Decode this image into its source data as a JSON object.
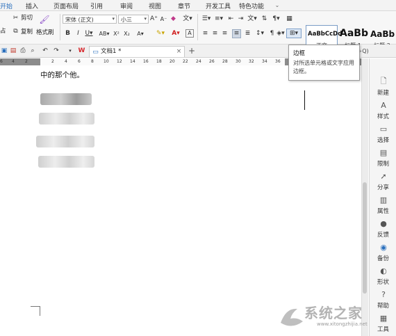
{
  "menu": {
    "tabs": [
      {
        "label": "开始",
        "active": true
      },
      {
        "label": "插入"
      },
      {
        "label": "页面布局"
      },
      {
        "label": "引用"
      },
      {
        "label": "审阅"
      },
      {
        "label": "视图"
      },
      {
        "label": "章节"
      },
      {
        "label": "开发工具"
      },
      {
        "label": "特色功能"
      }
    ]
  },
  "ribbon": {
    "cut_label": "剪切",
    "copy_label": "复制",
    "format_painter_label": "格式刷",
    "paste_label_fragment": "占",
    "font_name": "宋体 (正文)",
    "font_size": "小三",
    "styles": [
      {
        "preview": "AaBbCcDd",
        "label": "正文"
      },
      {
        "preview": "AaBb",
        "label": "标题 1"
      },
      {
        "preview": "AaBb",
        "label": "标题 2"
      }
    ]
  },
  "docbar": {
    "doc_tab_label": "文档1 *",
    "command_hint": "命令 (Alt+Q)"
  },
  "tooltip": {
    "title": "边框",
    "description": "对所选单元格或文字应用边框。"
  },
  "ruler": {
    "ticks": [
      "6",
      "4",
      "2",
      "2",
      "4",
      "6",
      "8",
      "10",
      "12",
      "14",
      "16",
      "18",
      "20",
      "22",
      "24",
      "26",
      "28",
      "30",
      "32",
      "34",
      "36"
    ]
  },
  "document": {
    "first_line": "中的那个他。"
  },
  "right_panel": {
    "items": [
      {
        "label": "新建",
        "icon": "new-doc-icon"
      },
      {
        "label": "样式",
        "icon": "style-icon"
      },
      {
        "label": "选择",
        "icon": "select-icon"
      },
      {
        "label": "限制",
        "icon": "restrict-icon"
      },
      {
        "label": "分享",
        "icon": "share-icon"
      },
      {
        "label": "属性",
        "icon": "properties-icon"
      },
      {
        "label": "反馈",
        "icon": "feedback-icon"
      },
      {
        "label": "备份",
        "icon": "backup-icon"
      },
      {
        "label": "形状",
        "icon": "shape-icon"
      },
      {
        "label": "帮助",
        "icon": "help-icon"
      },
      {
        "label": "工具",
        "icon": "tools-icon"
      }
    ]
  },
  "watermark": {
    "text": "系统之家",
    "url": "www.xitongzhijia.net"
  },
  "colors": {
    "accent": "#2a6fbd",
    "ruler_dark": "#8c8c8c",
    "wps_red": "#d6262b"
  }
}
